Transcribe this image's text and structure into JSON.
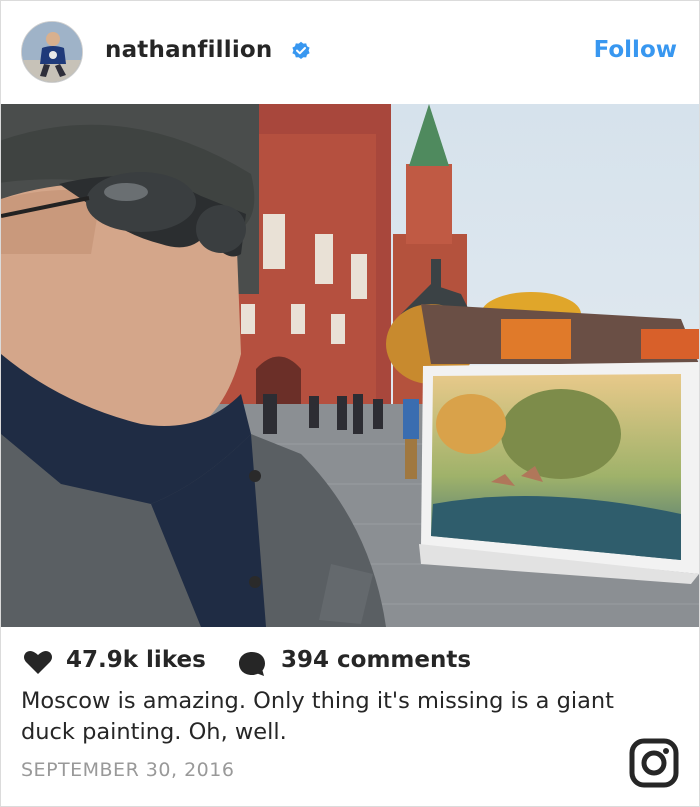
{
  "post": {
    "username": "nathanfillion",
    "follow_label": "Follow",
    "likes": "47.9k likes",
    "comments": "394 comments",
    "caption": "Moscow is amazing. Only thing it's missing is a giant duck painting. Oh, well.",
    "date": "SEPTEMBER 30, 2016"
  },
  "icons": {
    "verified": "verified-badge-icon",
    "likes": "heart-icon",
    "comments": "comment-bubble-icon",
    "brand": "instagram-icon"
  },
  "colors": {
    "follow": "#3897f0",
    "verified": "#3897f0",
    "text": "#262626",
    "muted": "#999999",
    "border": "#dbdbdb"
  }
}
